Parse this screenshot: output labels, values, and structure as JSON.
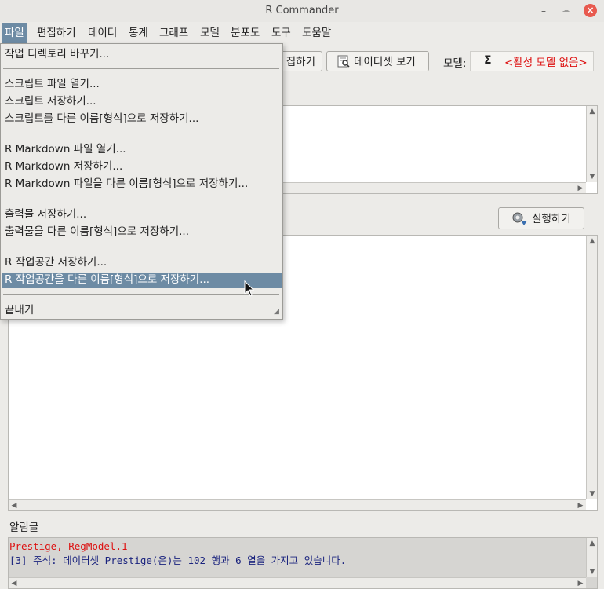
{
  "window": {
    "title": "R Commander",
    "minimize": "‹",
    "restore": "◦",
    "close": "×"
  },
  "menubar": [
    "파일",
    "편집하기",
    "데이터",
    "통계",
    "그래프",
    "모델",
    "분포도",
    "도구",
    "도움말"
  ],
  "toolbar": {
    "edit_dataset_partial": "집하기",
    "view_dataset": "데이터셋 보기",
    "model_label": "모델:",
    "model_sigma": "Σ",
    "model_value": "<활성 모델 없음>"
  },
  "submit_button": "실행하기",
  "messages_label": "알림글",
  "messages": [
    {
      "text": "Prestige, RegModel.1",
      "color": "#d11"
    },
    {
      "text": "[3] 주석: 데이터셋 Prestige(은)는 102 행과 6 열을 가지고 있습니다.",
      "color": "#1a237e"
    }
  ],
  "file_menu": {
    "items": [
      "작업 디렉토리 바꾸기...",
      "스크립트 파일 열기...",
      "스크립트 저장하기...",
      "스크립트를 다른 이름[형식]으로 저장하기...",
      "R Markdown 파일 열기...",
      "R Markdown 저장하기...",
      "R Markdown 파일을 다른 이름[형식]으로 저장하기...",
      "출력물 저장하기...",
      "출력물을 다른 이름[형식]으로 저장하기...",
      "R 작업공간 저장하기...",
      "R 작업공간을 다른 이름[형식]으로 저장하기...",
      "끝내기"
    ],
    "highlighted_index": 10
  },
  "colors": {
    "accent": "#6d8ba4",
    "error": "#d11",
    "note": "#1a237e"
  }
}
